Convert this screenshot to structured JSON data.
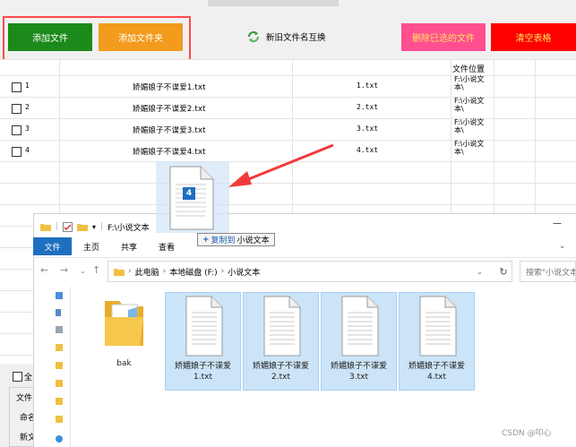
{
  "toolbar": {
    "add_file": "添加文件",
    "add_folder": "添加文件夹",
    "swap_names": "新旧文件名互换",
    "delete_selected": "删除已选的文件",
    "clear_table": "清空表格"
  },
  "table": {
    "path_header": "文件位置",
    "rows": [
      {
        "index": "1",
        "old_name": "娇媚娘子不谍爱1.txt",
        "new_name": "1.txt",
        "path": "F:\\小说文本\\"
      },
      {
        "index": "2",
        "old_name": "娇媚娘子不谍爱2.txt",
        "new_name": "2.txt",
        "path": "F:\\小说文本\\"
      },
      {
        "index": "3",
        "old_name": "娇媚娘子不谍爱3.txt",
        "new_name": "3.txt",
        "path": "F:\\小说文本\\"
      },
      {
        "index": "4",
        "old_name": "娇媚娘子不谍爱4.txt",
        "new_name": "4.txt",
        "path": "F:\\小说文本\\"
      }
    ]
  },
  "left_panel": {
    "select_all": "全",
    "group_label": "文件",
    "naming_label": "命名",
    "new_label": "新文"
  },
  "drag": {
    "count": "4",
    "verb": "复制到",
    "target": "小说文本"
  },
  "explorer": {
    "title": "F:\\小说文本",
    "tabs": [
      "文件",
      "主页",
      "共享",
      "查看"
    ],
    "breadcrumb": [
      "此电脑",
      "本地磁盘 (F:)",
      "小说文本"
    ],
    "search_placeholder": "搜索\"小说文本\"",
    "items": [
      {
        "name": "bak",
        "type": "folder",
        "selected": false
      },
      {
        "name": "娇媚娘子不谍爱1.txt",
        "type": "text-file",
        "selected": true
      },
      {
        "name": "娇媚娘子不谍爱2.txt",
        "type": "text-file",
        "selected": true
      },
      {
        "name": "娇媚娘子不谍爱3.txt",
        "type": "text-file",
        "selected": true
      },
      {
        "name": "娇媚娘子不谍爱4.txt",
        "type": "text-file",
        "selected": true
      }
    ]
  },
  "watermark": "CSDN @叩心",
  "colors": {
    "add_file": "#1b8a1b",
    "add_folder": "#f29b1c",
    "delete_selected": "#ff4f91",
    "clear_table": "#ff0000",
    "highlight": "#ff4b4b",
    "selection": "#cce4f7",
    "ribbon_file_tab": "#1f6fc0"
  }
}
